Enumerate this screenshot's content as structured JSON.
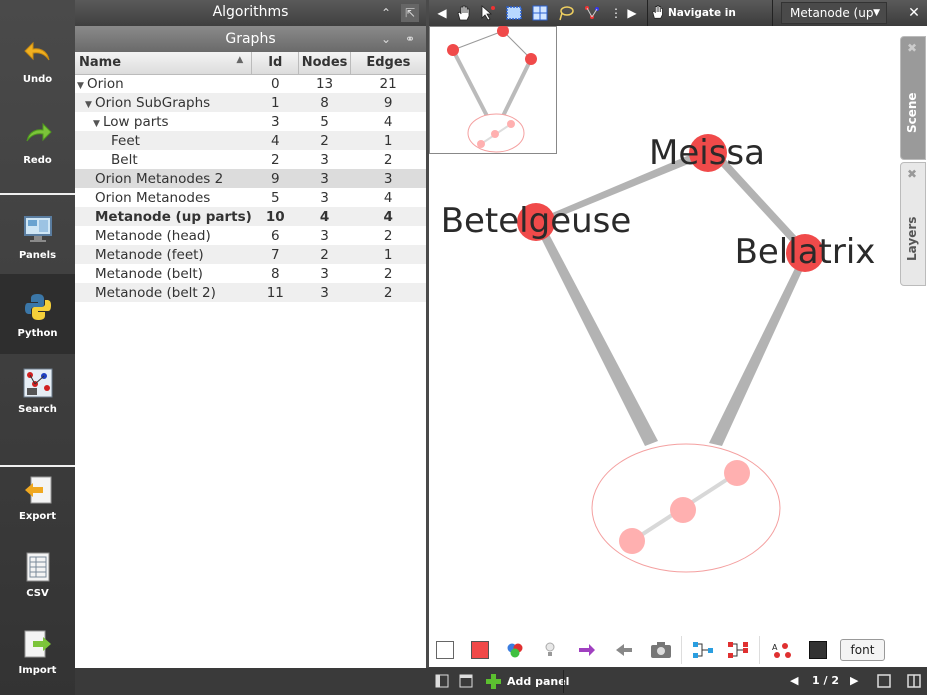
{
  "left_panel": {
    "buttons": [
      {
        "label": "Undo",
        "icon": "undo-arrow-icon"
      },
      {
        "label": "Redo",
        "icon": "redo-arrow-icon"
      },
      {
        "label": "Panels",
        "icon": "monitor-icon"
      },
      {
        "label": "Python",
        "icon": "python-logo-icon"
      },
      {
        "label": "Search",
        "icon": "graph-search-icon"
      },
      {
        "label": "Export",
        "icon": "export-icon"
      },
      {
        "label": "CSV",
        "icon": "csv-file-icon"
      },
      {
        "label": "Import",
        "icon": "import-icon"
      }
    ]
  },
  "algorithms_title": "Algorithms",
  "graphs": {
    "title": "Graphs",
    "columns": [
      "Name",
      "Id",
      "Nodes",
      "Edges"
    ],
    "rows": [
      {
        "name": "Orion",
        "id": "0",
        "nodes": "13",
        "edges": "21",
        "indent": 0,
        "expand": true
      },
      {
        "name": "Orion SubGraphs",
        "id": "1",
        "nodes": "8",
        "edges": "9",
        "indent": 1,
        "expand": true
      },
      {
        "name": "Low parts",
        "id": "3",
        "nodes": "5",
        "edges": "4",
        "indent": 2,
        "expand": true
      },
      {
        "name": "Feet",
        "id": "4",
        "nodes": "2",
        "edges": "1",
        "indent": 3,
        "expand": false
      },
      {
        "name": "Belt",
        "id": "2",
        "nodes": "3",
        "edges": "2",
        "indent": 3,
        "expand": false
      },
      {
        "name": "Orion Metanodes 2",
        "id": "9",
        "nodes": "3",
        "edges": "3",
        "indent": 1,
        "expand": false
      },
      {
        "name": "Orion Metanodes",
        "id": "5",
        "nodes": "3",
        "edges": "4",
        "indent": 1,
        "expand": false
      },
      {
        "name": "Metanode (up parts)",
        "id": "10",
        "nodes": "4",
        "edges": "4",
        "indent": 1,
        "expand": false,
        "bold": true
      },
      {
        "name": "Metanode (head)",
        "id": "6",
        "nodes": "3",
        "edges": "2",
        "indent": 1,
        "expand": false
      },
      {
        "name": "Metanode (feet)",
        "id": "7",
        "nodes": "2",
        "edges": "1",
        "indent": 1,
        "expand": false
      },
      {
        "name": "Metanode (belt)",
        "id": "8",
        "nodes": "3",
        "edges": "2",
        "indent": 1,
        "expand": false
      },
      {
        "name": "Metanode (belt 2)",
        "id": "11",
        "nodes": "3",
        "edges": "2",
        "indent": 1,
        "expand": false
      }
    ]
  },
  "view_toolbar": {
    "navigate_label": "Navigate in graph",
    "view_select": "Metanode (up"
  },
  "graph_view": {
    "nodes": [
      {
        "label": "Meissa"
      },
      {
        "label": "Betelgeuse"
      },
      {
        "label": "Bellatrix"
      }
    ]
  },
  "side_tabs": [
    "Scene",
    "Layers"
  ],
  "bottom": {
    "font_button": "font",
    "add_panel": "Add panel",
    "page": "1 / 2"
  },
  "colors": {
    "node": "#f04a4a",
    "meta_node": "#ffb0b0",
    "edge": "#b3b3b3"
  }
}
